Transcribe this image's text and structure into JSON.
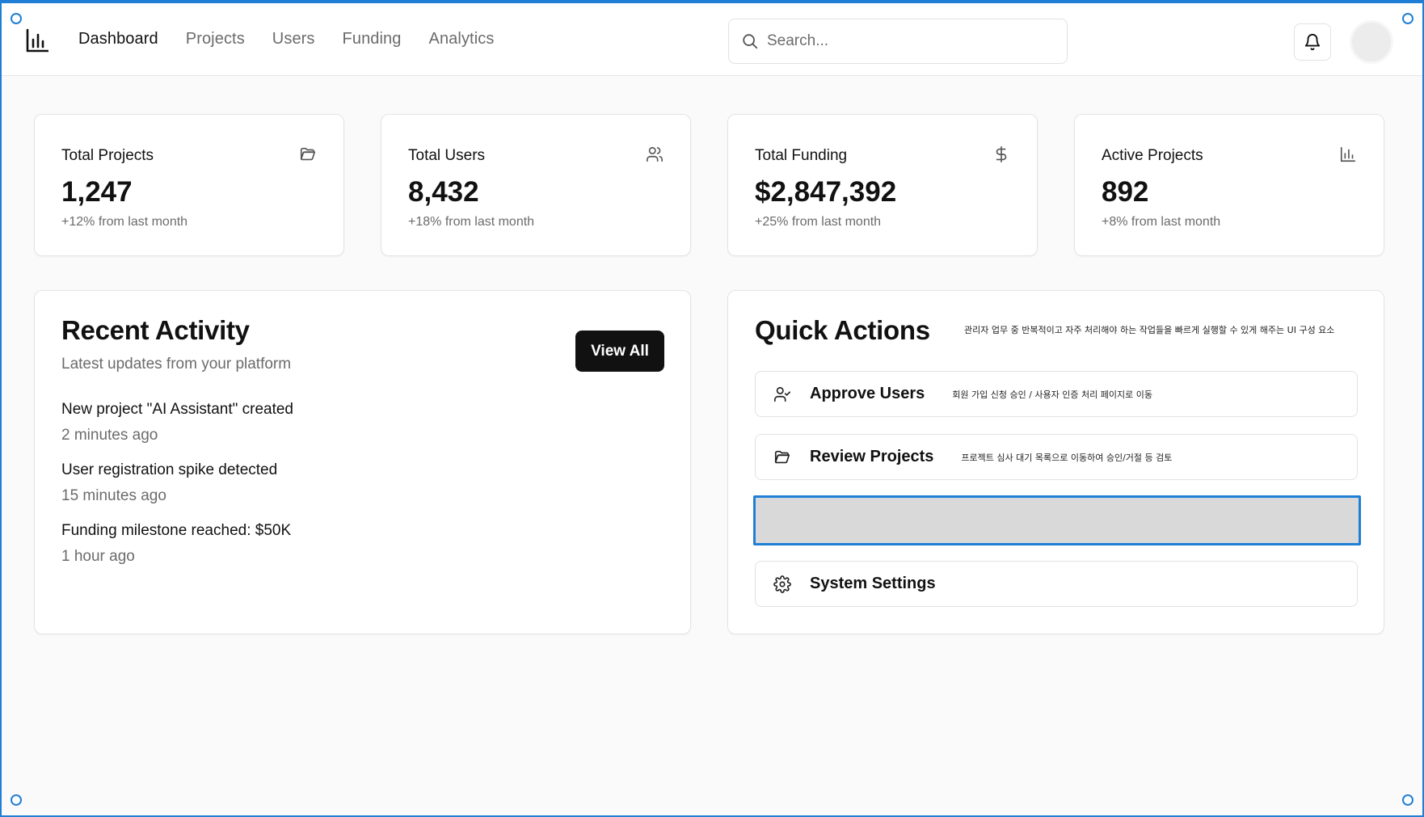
{
  "nav": {
    "items": [
      {
        "label": "Dashboard",
        "active": true
      },
      {
        "label": "Projects",
        "active": false
      },
      {
        "label": "Users",
        "active": false
      },
      {
        "label": "Funding",
        "active": false
      },
      {
        "label": "Analytics",
        "active": false
      }
    ]
  },
  "search": {
    "placeholder": "Search..."
  },
  "stats": [
    {
      "label": "Total Projects",
      "value": "1,247",
      "change": "+12% from last month",
      "icon": "folder-icon"
    },
    {
      "label": "Total Users",
      "value": "8,432",
      "change": "+18% from last month",
      "icon": "users-icon"
    },
    {
      "label": "Total Funding",
      "value": "$2,847,392",
      "change": "+25% from last month",
      "icon": "dollar-icon"
    },
    {
      "label": "Active Projects",
      "value": "892",
      "change": "+8% from last month",
      "icon": "bar-chart-icon"
    }
  ],
  "recent_activity": {
    "title": "Recent Activity",
    "subtitle": "Latest updates from your platform",
    "view_all_label": "View All",
    "items": [
      {
        "title": "New project \"AI Assistant\" created",
        "time": "2 minutes ago"
      },
      {
        "title": "User registration spike detected",
        "time": "15 minutes ago"
      },
      {
        "title": "Funding milestone reached: $50K",
        "time": "1 hour ago"
      }
    ]
  },
  "quick_actions": {
    "title": "Quick Actions",
    "note": "관리자 업무 중 반복적이고 자주 처리해야 하는 작업들을 빠르게 실행할 수 있게 해주는 UI 구성 요소",
    "actions": [
      {
        "label": "Approve Users",
        "description": "회원 가입 신청 승인 / 사용자 인증 처리 페이지로 이동",
        "icon": "user-check-icon"
      },
      {
        "label": "Review Projects",
        "description": "프로젝트 심사 대기 목록으로 이동하여 승인/거절 등 검토",
        "icon": "folder-icon"
      },
      {
        "label": "",
        "description": "",
        "icon": ""
      },
      {
        "label": "System Settings",
        "description": "",
        "icon": "gear-icon"
      }
    ]
  },
  "colors": {
    "accent": "#1f7fd6",
    "primary_button": "#111111",
    "muted_text": "#6b6b6b",
    "placeholder_fill": "#d9d9d9"
  }
}
